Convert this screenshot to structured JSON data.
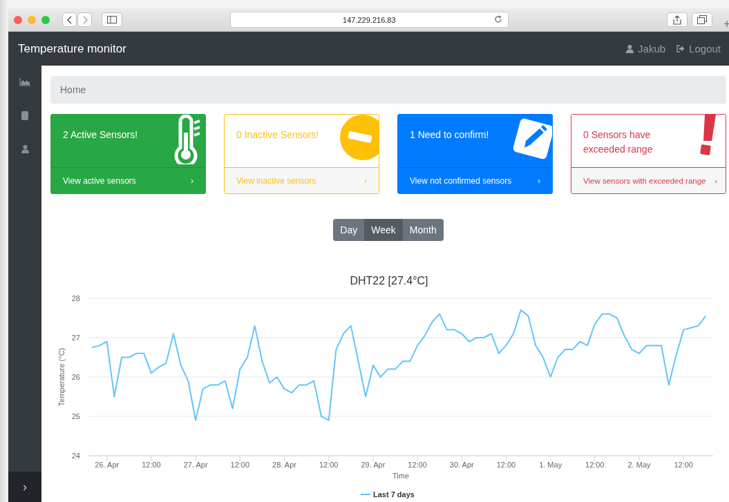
{
  "browser": {
    "address": "147.229.216.83"
  },
  "navbar": {
    "brand": "Temperature monitor",
    "user": "Jakub",
    "logout": "Logout"
  },
  "breadcrumb": {
    "label": "Home"
  },
  "cards": [
    {
      "kind": "success",
      "title": "2 Active Sensors!",
      "link": "View active sensors",
      "arrow": "›"
    },
    {
      "kind": "warning",
      "title": "0 Inactive Sensors!",
      "link": "View inactive sensors",
      "arrow": "›"
    },
    {
      "kind": "primary",
      "title": "1 Need to confirm!",
      "link": "View not confirmed sensors",
      "arrow": "›"
    },
    {
      "kind": "danger",
      "title": "0 Sensors have exceeded range",
      "link": "View sensors with exceeded range",
      "arrow": "›"
    }
  ],
  "range_buttons": [
    {
      "label": "Day",
      "selected": false
    },
    {
      "label": "Week",
      "selected": true
    },
    {
      "label": "Month",
      "selected": false
    }
  ],
  "sidebar": {
    "toggle": "›"
  },
  "chart": {
    "chart_data": {
      "type": "line",
      "title": "DHT22 [27.4°C]",
      "xlabel": "Time",
      "ylabel": "Temperature (°C)",
      "categories": [
        null,
        null,
        "26. Apr",
        null,
        null,
        null,
        null,
        null,
        "12:00",
        null,
        null,
        null,
        null,
        null,
        "27. Apr",
        null,
        null,
        null,
        null,
        null,
        "12:00",
        null,
        null,
        null,
        null,
        null,
        "28. Apr",
        null,
        null,
        null,
        null,
        null,
        "12:00",
        null,
        null,
        null,
        null,
        null,
        "29. Apr",
        null,
        null,
        null,
        null,
        null,
        "12:00",
        null,
        null,
        null,
        null,
        null,
        "30. Apr",
        null,
        null,
        null,
        null,
        null,
        "12:00",
        null,
        null,
        null,
        null,
        null,
        "1. May",
        null,
        null,
        null,
        null,
        null,
        "12:00",
        null,
        null,
        null,
        null,
        null,
        "2. May",
        null,
        null,
        null,
        null,
        null,
        "12:00",
        null,
        null,
        null
      ],
      "series": [
        {
          "name": "Last 7 days",
          "color": "#62c6fa",
          "values": [
            26.75,
            26.8,
            26.9,
            25.5,
            26.5,
            26.5,
            26.6,
            26.6,
            26.1,
            26.25,
            26.35,
            27.1,
            26.3,
            25.9,
            24.9,
            25.7,
            25.8,
            25.8,
            25.9,
            25.2,
            26.2,
            26.5,
            27.3,
            26.4,
            25.85,
            26.0,
            25.7,
            25.6,
            25.8,
            25.8,
            25.9,
            25.0,
            24.9,
            26.7,
            27.1,
            27.3,
            26.4,
            25.5,
            26.3,
            26.0,
            26.2,
            26.2,
            26.4,
            26.4,
            26.8,
            27.05,
            27.4,
            27.6,
            27.2,
            27.2,
            27.1,
            26.9,
            27.0,
            27.0,
            27.1,
            26.6,
            26.8,
            27.1,
            27.7,
            27.55,
            26.8,
            26.5,
            26.0,
            26.5,
            26.7,
            26.7,
            26.9,
            26.8,
            27.35,
            27.6,
            27.6,
            27.5,
            27.05,
            26.7,
            26.6,
            26.8,
            26.8,
            26.8,
            25.8,
            26.55,
            27.2,
            27.25,
            27.3,
            27.55
          ]
        }
      ],
      "ylim": [
        24,
        28
      ],
      "grid": true,
      "yticks": [
        24,
        25,
        26,
        27,
        28
      ]
    }
  }
}
